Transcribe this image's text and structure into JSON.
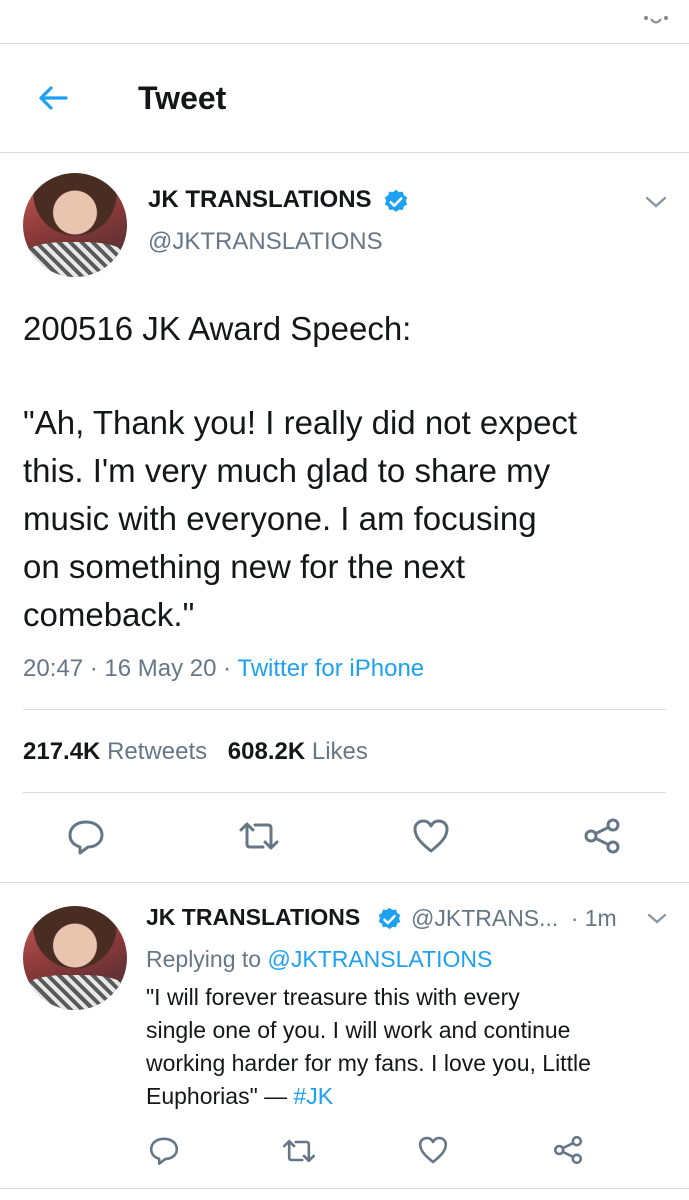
{
  "status_bar": {
    "icon": "status-icon"
  },
  "header": {
    "title": "Tweet",
    "back_icon": "back-arrow-icon"
  },
  "tweet": {
    "author_name": "JK TRANSLATIONS",
    "author_handle": "@JKTRANSLATIONS",
    "text_line1": "200516 JK Award Speech:",
    "text_body": [
      "\"Ah, Thank you! I really did not expect",
      "this. I'm very much glad to share my",
      "music with everyone. I am focusing",
      "on something new for the next",
      "comeback.\""
    ],
    "time": "20:47",
    "date": "16 May 20",
    "source": "Twitter for iPhone",
    "retweets_count": "217.4K",
    "retweets_label": "Retweets",
    "likes_count": "608.2K",
    "likes_label": "Likes"
  },
  "reply": {
    "author_name": "JK TRANSLATIONS",
    "author_handle": "@JKTRANS...",
    "separator": "·",
    "time": "1m",
    "replying_prefix": "Replying to",
    "replying_handle": "@JKTRANSLATIONS",
    "text_lines": [
      "\"I will forever treasure this with every",
      "single one of you. I will work and continue",
      "working harder for my fans. I love you, Little"
    ],
    "text_last": "Euphorias\" — ",
    "hashtag": "#JK"
  },
  "colors": {
    "accent": "#1da1f2",
    "text": "#14171a",
    "muted": "#657786",
    "divider": "#d6dde3"
  }
}
